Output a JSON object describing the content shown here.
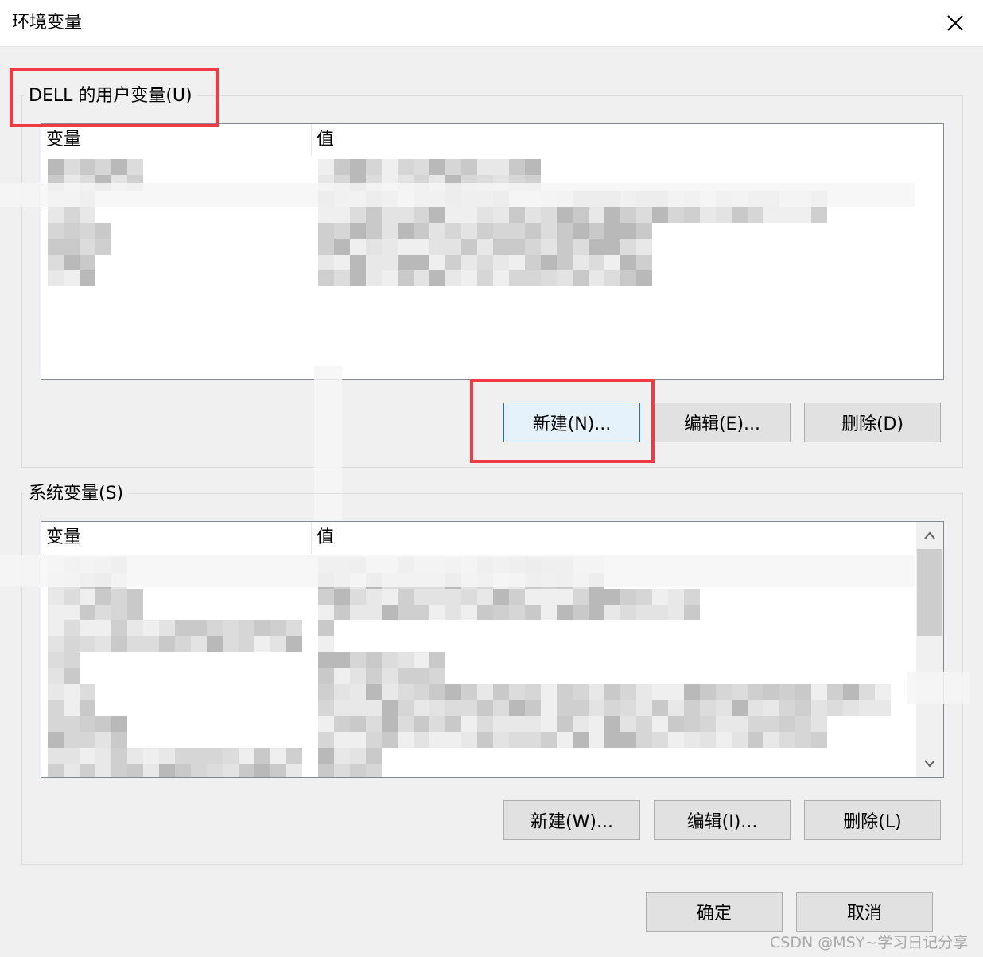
{
  "window": {
    "title": "环境变量",
    "close_icon": "close-icon"
  },
  "user_vars": {
    "label": "DELL 的用户变量(U)",
    "col_variable": "变量",
    "col_value": "值",
    "buttons": {
      "new": "新建(N)...",
      "edit": "编辑(E)...",
      "delete": "删除(D)"
    }
  },
  "system_vars": {
    "label": "系统变量(S)",
    "col_variable": "变量",
    "col_value": "值",
    "buttons": {
      "new": "新建(W)...",
      "edit": "编辑(I)...",
      "delete": "删除(L)"
    }
  },
  "footer": {
    "ok": "确定",
    "cancel": "取消"
  },
  "watermark": "CSDN @MSY~学习日记分享",
  "colors": {
    "highlight_box": "#ef3b41",
    "focus_border": "#0078d7",
    "focus_fill": "#e5f1fb"
  },
  "scroll_icons": {
    "up": "chevron-up-icon",
    "down": "chevron-down-icon"
  }
}
